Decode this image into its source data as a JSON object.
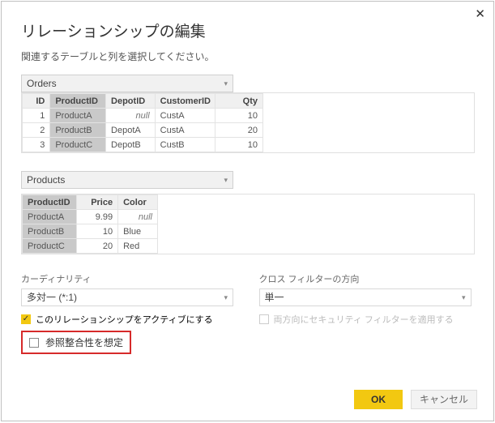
{
  "dialog": {
    "title": "リレーションシップの編集",
    "subtitle": "関連するテーブルと列を選択してください。"
  },
  "table1": {
    "selected": "Orders",
    "columns": [
      "ID",
      "ProductID",
      "DepotID",
      "CustomerID",
      "Qty"
    ],
    "highlightedColumn": "ProductID",
    "rows": [
      {
        "ID": "1",
        "ProductID": "ProductA",
        "DepotID": "null",
        "CustomerID": "CustA",
        "Qty": "10"
      },
      {
        "ID": "2",
        "ProductID": "ProductB",
        "DepotID": "DepotA",
        "CustomerID": "CustA",
        "Qty": "20"
      },
      {
        "ID": "3",
        "ProductID": "ProductC",
        "DepotID": "DepotB",
        "CustomerID": "CustB",
        "Qty": "10"
      }
    ]
  },
  "table2": {
    "selected": "Products",
    "columns": [
      "ProductID",
      "Price",
      "Color"
    ],
    "highlightedColumn": "ProductID",
    "rows": [
      {
        "ProductID": "ProductA",
        "Price": "9.99",
        "Color": "null"
      },
      {
        "ProductID": "ProductB",
        "Price": "10",
        "Color": "Blue"
      },
      {
        "ProductID": "ProductC",
        "Price": "20",
        "Color": "Red"
      }
    ]
  },
  "options": {
    "cardinality": {
      "label": "カーディナリティ",
      "value": "多対一 (*:1)"
    },
    "crossfilter": {
      "label": "クロス フィルターの方向",
      "value": "単一"
    },
    "activate": "このリレーションシップをアクティブにする",
    "applyBoth": "両方向にセキュリティ フィルターを適用する",
    "referential": "参照整合性を想定"
  },
  "buttons": {
    "ok": "OK",
    "cancel": "キャンセル"
  }
}
